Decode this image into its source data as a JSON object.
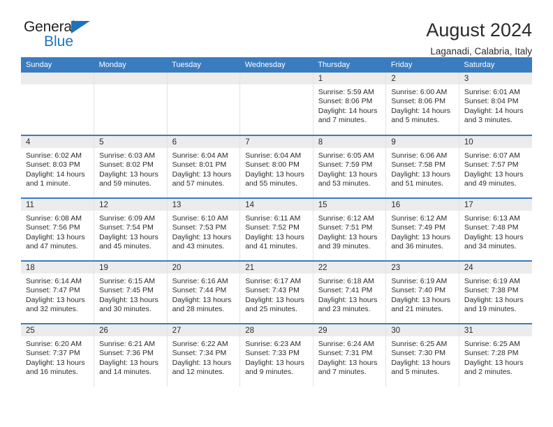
{
  "brand": {
    "name_part1": "General",
    "name_part2": "Blue",
    "accent_color": "#1c75bc"
  },
  "header": {
    "title": "August 2024",
    "subtitle": "Laganadi, Calabria, Italy",
    "header_bg_color": "#3a7cc0"
  },
  "weekday_headers": [
    "Sunday",
    "Monday",
    "Tuesday",
    "Wednesday",
    "Thursday",
    "Friday",
    "Saturday"
  ],
  "weeks": [
    [
      {
        "day": "",
        "blank": true,
        "sunrise": "",
        "sunset": "",
        "daylight_1": "",
        "daylight_2": ""
      },
      {
        "day": "",
        "blank": true,
        "sunrise": "",
        "sunset": "",
        "daylight_1": "",
        "daylight_2": ""
      },
      {
        "day": "",
        "blank": true,
        "sunrise": "",
        "sunset": "",
        "daylight_1": "",
        "daylight_2": ""
      },
      {
        "day": "",
        "blank": true,
        "sunrise": "",
        "sunset": "",
        "daylight_1": "",
        "daylight_2": ""
      },
      {
        "day": "1",
        "blank": false,
        "sunrise": "Sunrise: 5:59 AM",
        "sunset": "Sunset: 8:06 PM",
        "daylight_1": "Daylight: 14 hours",
        "daylight_2": "and 7 minutes."
      },
      {
        "day": "2",
        "blank": false,
        "sunrise": "Sunrise: 6:00 AM",
        "sunset": "Sunset: 8:06 PM",
        "daylight_1": "Daylight: 14 hours",
        "daylight_2": "and 5 minutes."
      },
      {
        "day": "3",
        "blank": false,
        "sunrise": "Sunrise: 6:01 AM",
        "sunset": "Sunset: 8:04 PM",
        "daylight_1": "Daylight: 14 hours",
        "daylight_2": "and 3 minutes."
      }
    ],
    [
      {
        "day": "4",
        "blank": false,
        "sunrise": "Sunrise: 6:02 AM",
        "sunset": "Sunset: 8:03 PM",
        "daylight_1": "Daylight: 14 hours",
        "daylight_2": "and 1 minute."
      },
      {
        "day": "5",
        "blank": false,
        "sunrise": "Sunrise: 6:03 AM",
        "sunset": "Sunset: 8:02 PM",
        "daylight_1": "Daylight: 13 hours",
        "daylight_2": "and 59 minutes."
      },
      {
        "day": "6",
        "blank": false,
        "sunrise": "Sunrise: 6:04 AM",
        "sunset": "Sunset: 8:01 PM",
        "daylight_1": "Daylight: 13 hours",
        "daylight_2": "and 57 minutes."
      },
      {
        "day": "7",
        "blank": false,
        "sunrise": "Sunrise: 6:04 AM",
        "sunset": "Sunset: 8:00 PM",
        "daylight_1": "Daylight: 13 hours",
        "daylight_2": "and 55 minutes."
      },
      {
        "day": "8",
        "blank": false,
        "sunrise": "Sunrise: 6:05 AM",
        "sunset": "Sunset: 7:59 PM",
        "daylight_1": "Daylight: 13 hours",
        "daylight_2": "and 53 minutes."
      },
      {
        "day": "9",
        "blank": false,
        "sunrise": "Sunrise: 6:06 AM",
        "sunset": "Sunset: 7:58 PM",
        "daylight_1": "Daylight: 13 hours",
        "daylight_2": "and 51 minutes."
      },
      {
        "day": "10",
        "blank": false,
        "sunrise": "Sunrise: 6:07 AM",
        "sunset": "Sunset: 7:57 PM",
        "daylight_1": "Daylight: 13 hours",
        "daylight_2": "and 49 minutes."
      }
    ],
    [
      {
        "day": "11",
        "blank": false,
        "sunrise": "Sunrise: 6:08 AM",
        "sunset": "Sunset: 7:56 PM",
        "daylight_1": "Daylight: 13 hours",
        "daylight_2": "and 47 minutes."
      },
      {
        "day": "12",
        "blank": false,
        "sunrise": "Sunrise: 6:09 AM",
        "sunset": "Sunset: 7:54 PM",
        "daylight_1": "Daylight: 13 hours",
        "daylight_2": "and 45 minutes."
      },
      {
        "day": "13",
        "blank": false,
        "sunrise": "Sunrise: 6:10 AM",
        "sunset": "Sunset: 7:53 PM",
        "daylight_1": "Daylight: 13 hours",
        "daylight_2": "and 43 minutes."
      },
      {
        "day": "14",
        "blank": false,
        "sunrise": "Sunrise: 6:11 AM",
        "sunset": "Sunset: 7:52 PM",
        "daylight_1": "Daylight: 13 hours",
        "daylight_2": "and 41 minutes."
      },
      {
        "day": "15",
        "blank": false,
        "sunrise": "Sunrise: 6:12 AM",
        "sunset": "Sunset: 7:51 PM",
        "daylight_1": "Daylight: 13 hours",
        "daylight_2": "and 39 minutes."
      },
      {
        "day": "16",
        "blank": false,
        "sunrise": "Sunrise: 6:12 AM",
        "sunset": "Sunset: 7:49 PM",
        "daylight_1": "Daylight: 13 hours",
        "daylight_2": "and 36 minutes."
      },
      {
        "day": "17",
        "blank": false,
        "sunrise": "Sunrise: 6:13 AM",
        "sunset": "Sunset: 7:48 PM",
        "daylight_1": "Daylight: 13 hours",
        "daylight_2": "and 34 minutes."
      }
    ],
    [
      {
        "day": "18",
        "blank": false,
        "sunrise": "Sunrise: 6:14 AM",
        "sunset": "Sunset: 7:47 PM",
        "daylight_1": "Daylight: 13 hours",
        "daylight_2": "and 32 minutes."
      },
      {
        "day": "19",
        "blank": false,
        "sunrise": "Sunrise: 6:15 AM",
        "sunset": "Sunset: 7:45 PM",
        "daylight_1": "Daylight: 13 hours",
        "daylight_2": "and 30 minutes."
      },
      {
        "day": "20",
        "blank": false,
        "sunrise": "Sunrise: 6:16 AM",
        "sunset": "Sunset: 7:44 PM",
        "daylight_1": "Daylight: 13 hours",
        "daylight_2": "and 28 minutes."
      },
      {
        "day": "21",
        "blank": false,
        "sunrise": "Sunrise: 6:17 AM",
        "sunset": "Sunset: 7:43 PM",
        "daylight_1": "Daylight: 13 hours",
        "daylight_2": "and 25 minutes."
      },
      {
        "day": "22",
        "blank": false,
        "sunrise": "Sunrise: 6:18 AM",
        "sunset": "Sunset: 7:41 PM",
        "daylight_1": "Daylight: 13 hours",
        "daylight_2": "and 23 minutes."
      },
      {
        "day": "23",
        "blank": false,
        "sunrise": "Sunrise: 6:19 AM",
        "sunset": "Sunset: 7:40 PM",
        "daylight_1": "Daylight: 13 hours",
        "daylight_2": "and 21 minutes."
      },
      {
        "day": "24",
        "blank": false,
        "sunrise": "Sunrise: 6:19 AM",
        "sunset": "Sunset: 7:38 PM",
        "daylight_1": "Daylight: 13 hours",
        "daylight_2": "and 19 minutes."
      }
    ],
    [
      {
        "day": "25",
        "blank": false,
        "sunrise": "Sunrise: 6:20 AM",
        "sunset": "Sunset: 7:37 PM",
        "daylight_1": "Daylight: 13 hours",
        "daylight_2": "and 16 minutes."
      },
      {
        "day": "26",
        "blank": false,
        "sunrise": "Sunrise: 6:21 AM",
        "sunset": "Sunset: 7:36 PM",
        "daylight_1": "Daylight: 13 hours",
        "daylight_2": "and 14 minutes."
      },
      {
        "day": "27",
        "blank": false,
        "sunrise": "Sunrise: 6:22 AM",
        "sunset": "Sunset: 7:34 PM",
        "daylight_1": "Daylight: 13 hours",
        "daylight_2": "and 12 minutes."
      },
      {
        "day": "28",
        "blank": false,
        "sunrise": "Sunrise: 6:23 AM",
        "sunset": "Sunset: 7:33 PM",
        "daylight_1": "Daylight: 13 hours",
        "daylight_2": "and 9 minutes."
      },
      {
        "day": "29",
        "blank": false,
        "sunrise": "Sunrise: 6:24 AM",
        "sunset": "Sunset: 7:31 PM",
        "daylight_1": "Daylight: 13 hours",
        "daylight_2": "and 7 minutes."
      },
      {
        "day": "30",
        "blank": false,
        "sunrise": "Sunrise: 6:25 AM",
        "sunset": "Sunset: 7:30 PM",
        "daylight_1": "Daylight: 13 hours",
        "daylight_2": "and 5 minutes."
      },
      {
        "day": "31",
        "blank": false,
        "sunrise": "Sunrise: 6:25 AM",
        "sunset": "Sunset: 7:28 PM",
        "daylight_1": "Daylight: 13 hours",
        "daylight_2": "and 2 minutes."
      }
    ]
  ]
}
